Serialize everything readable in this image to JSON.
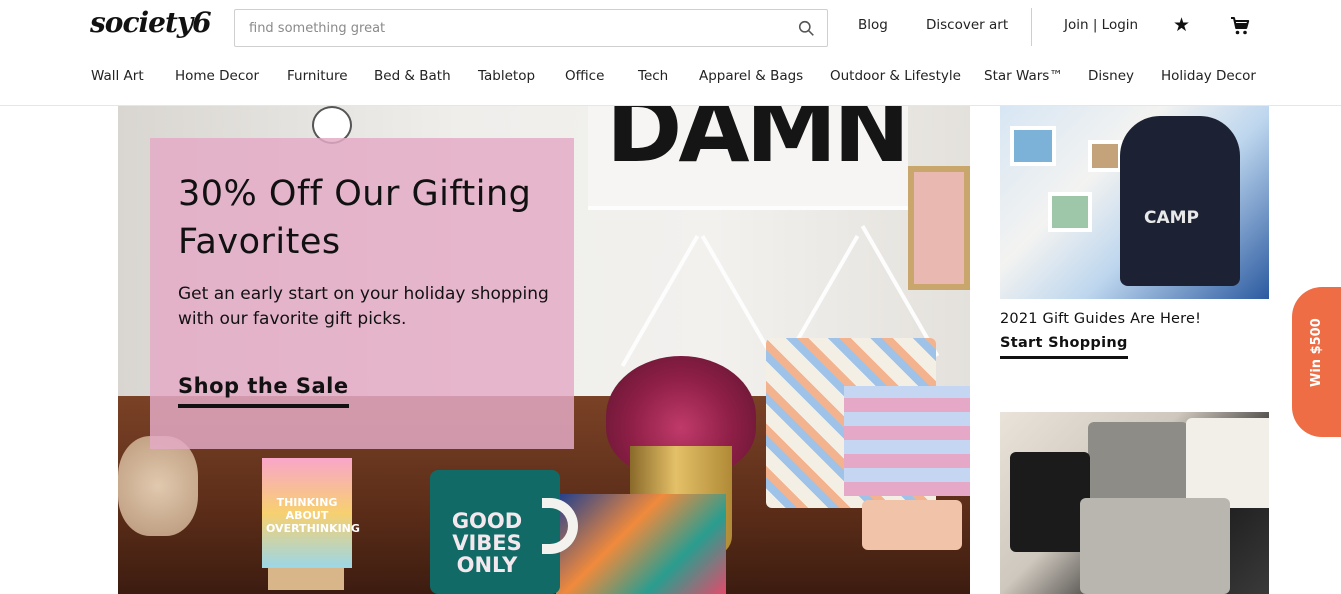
{
  "header": {
    "logo": "society6",
    "search_placeholder": "find something great",
    "blog": "Blog",
    "discover": "Discover art",
    "join_login": "Join | Login"
  },
  "nav": {
    "items": [
      "Wall Art",
      "Home Decor",
      "Furniture",
      "Bed & Bath",
      "Tabletop",
      "Office",
      "Tech",
      "Apparel & Bags",
      "Outdoor & Lifestyle",
      "Star Wars™",
      "Disney",
      "Holiday Decor"
    ]
  },
  "hero": {
    "title": "30% Off Our Gifting Favorites",
    "body": "Get an early start on your holiday shopping with our favorite gift picks.",
    "cta": "Shop the Sale",
    "sign_text": "DAMN",
    "mug_text": "GOOD VIBES ONLY",
    "card_text": "THINKING ABOUT OVERTHINKING"
  },
  "tiles": [
    {
      "caption": "2021 Gift Guides Are Here!",
      "link": "Start Shopping",
      "hoodie_text": "CAMP"
    }
  ],
  "badge": {
    "label": "Win $500",
    "color": "#ee6d45"
  },
  "colors": {
    "promo_bg": "#e4aac6",
    "accent": "#111111"
  },
  "icons": [
    "search-icon",
    "star-icon",
    "cart-icon"
  ]
}
